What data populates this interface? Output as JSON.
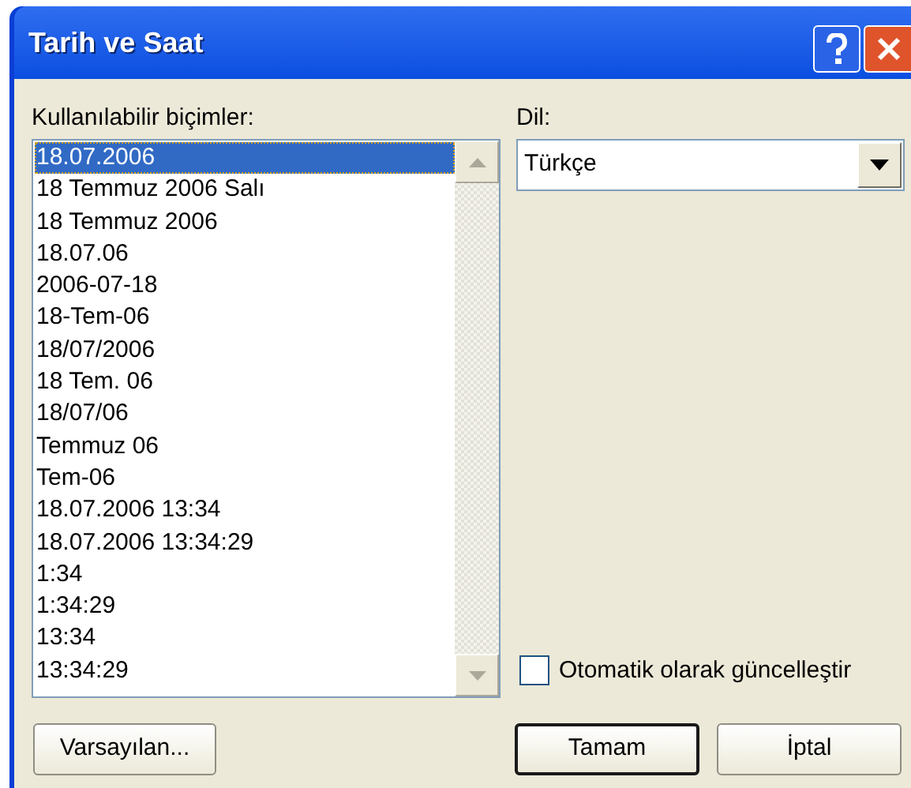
{
  "window": {
    "title": "Tarih ve Saat"
  },
  "formats": {
    "label": "Kullanılabilir biçimler:",
    "items": [
      {
        "text": "18.07.2006",
        "selected": true
      },
      {
        "text": "18 Temmuz 2006 Salı",
        "selected": false
      },
      {
        "text": "18 Temmuz 2006",
        "selected": false
      },
      {
        "text": "18.07.06",
        "selected": false
      },
      {
        "text": "2006-07-18",
        "selected": false
      },
      {
        "text": "18-Tem-06",
        "selected": false
      },
      {
        "text": "18/07/2006",
        "selected": false
      },
      {
        "text": "18 Tem. 06",
        "selected": false
      },
      {
        "text": "18/07/06",
        "selected": false
      },
      {
        "text": "Temmuz 06",
        "selected": false
      },
      {
        "text": "Tem-06",
        "selected": false
      },
      {
        "text": "18.07.2006 13:34",
        "selected": false
      },
      {
        "text": "18.07.2006 13:34:29",
        "selected": false
      },
      {
        "text": "1:34",
        "selected": false
      },
      {
        "text": "1:34:29",
        "selected": false
      },
      {
        "text": "13:34",
        "selected": false
      },
      {
        "text": "13:34:29",
        "selected": false
      }
    ]
  },
  "language": {
    "label": "Dil:",
    "value": "Türkçe"
  },
  "auto_update": {
    "label": "Otomatik olarak güncelleştir",
    "checked": false
  },
  "buttons": [
    {
      "label": "Varsayılan...",
      "default": false
    },
    {
      "label": "Tamam",
      "default": true
    },
    {
      "label": "İptal",
      "default": false
    }
  ]
}
